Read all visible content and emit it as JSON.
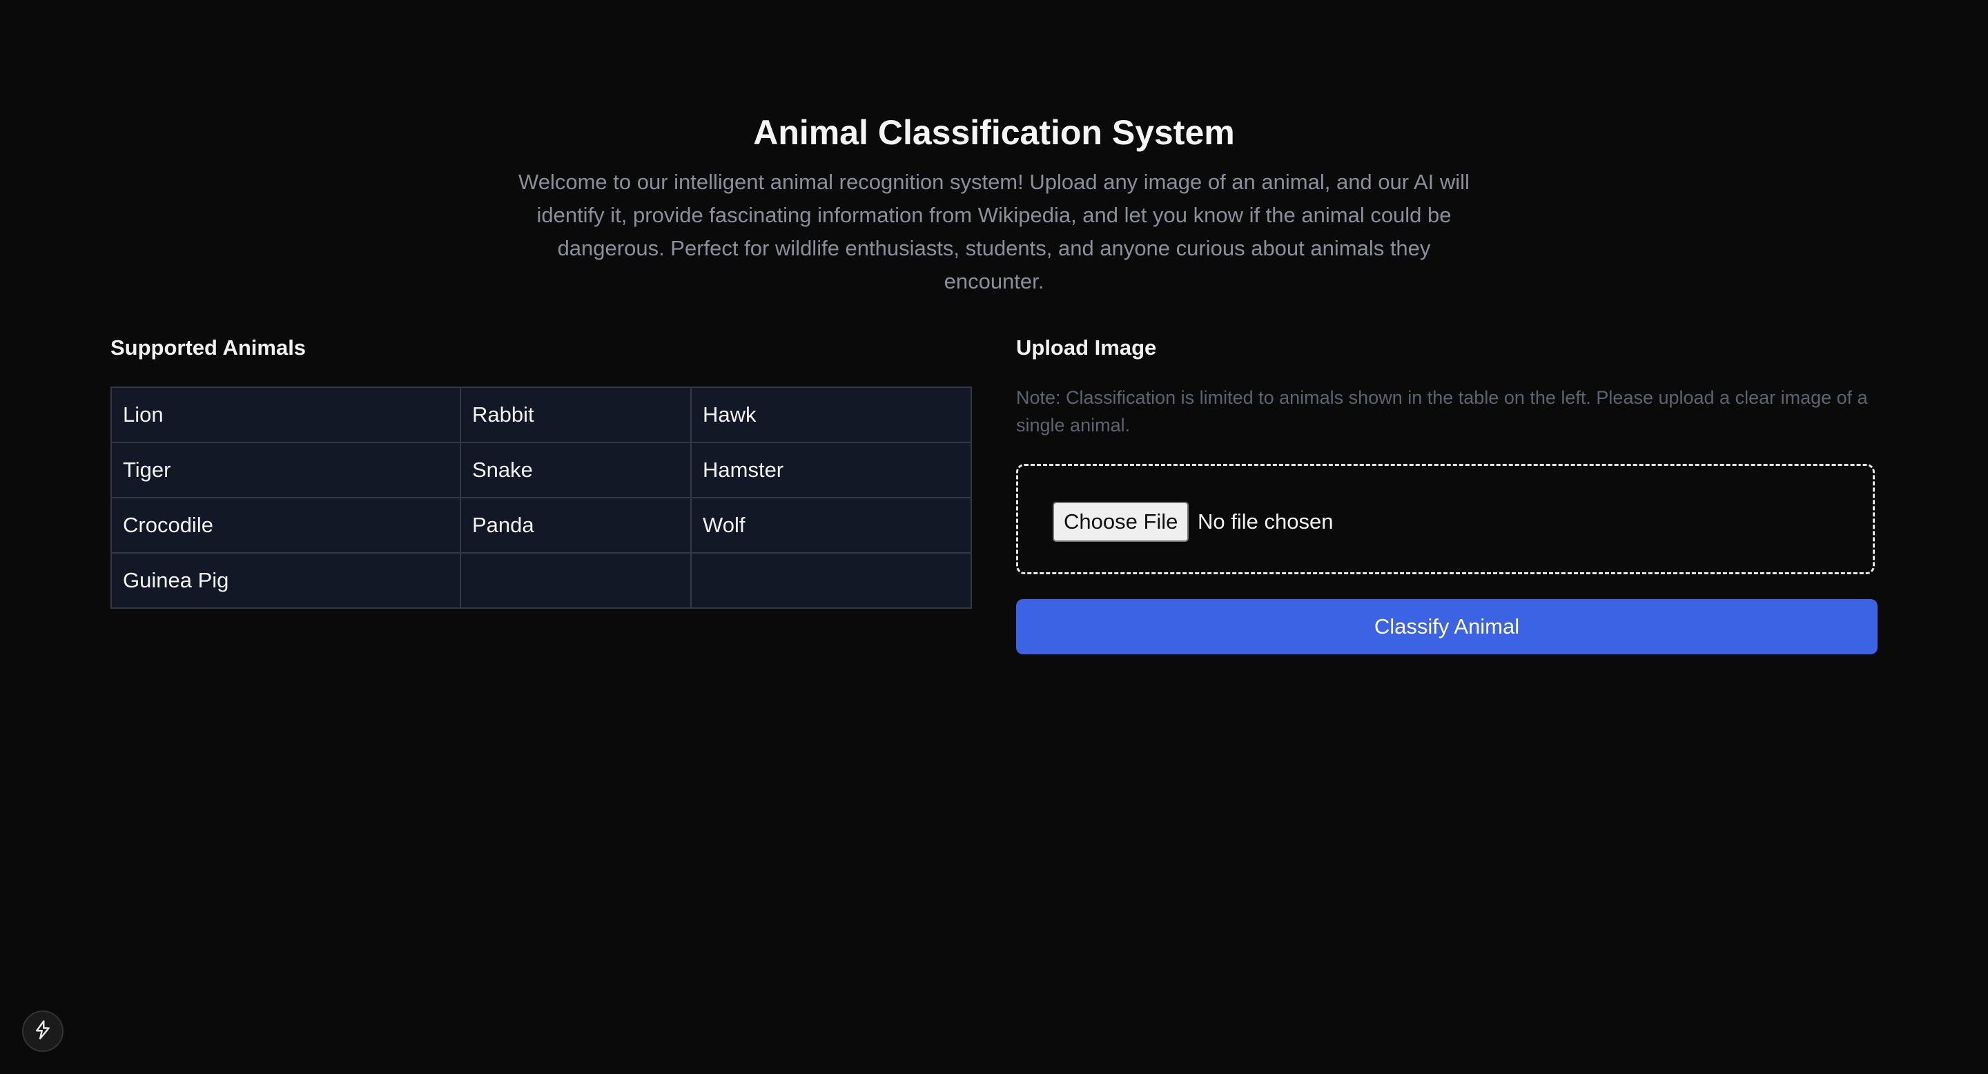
{
  "header": {
    "title": "Animal Classification System",
    "description": "Welcome to our intelligent animal recognition system! Upload any image of an animal, and our AI will identify it, provide fascinating information from Wikipedia, and let you know if the animal could be dangerous. Perfect for wildlife enthusiasts, students, and anyone curious about animals they encounter."
  },
  "supported": {
    "heading": "Supported Animals",
    "rows": [
      [
        "Lion",
        "Rabbit",
        "Hawk"
      ],
      [
        "Tiger",
        "Snake",
        "Hamster"
      ],
      [
        "Crocodile",
        "Panda",
        "Wolf"
      ],
      [
        "Guinea Pig",
        "",
        ""
      ]
    ]
  },
  "upload": {
    "heading": "Upload Image",
    "note": "Note: Classification is limited to animals shown in the table on the left. Please upload a clear image of a single animal.",
    "choose_file_label": "Choose File",
    "file_status": "No file chosen",
    "submit_label": "Classify Animal"
  },
  "floating": {
    "icon": "lightning-bolt-icon"
  },
  "colors": {
    "background": "#0a0a0a",
    "table_background": "#131826",
    "accent": "#3b63e4"
  }
}
